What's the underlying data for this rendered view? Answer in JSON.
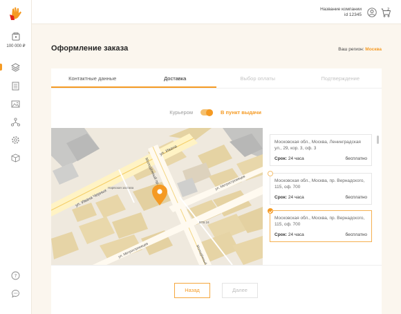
{
  "sidebar": {
    "balance": "100 000 ₽",
    "nav_icons": [
      "layers-icon",
      "document-icon",
      "image-icon",
      "network-icon",
      "settings-icon",
      "box-icon"
    ],
    "bottom_icons": [
      "help-icon",
      "chat-icon"
    ]
  },
  "header": {
    "company_name": "Название компании",
    "company_id": "id 12345",
    "cart_count": "2"
  },
  "page": {
    "title": "Оформление заказа",
    "region_label": "Ваш регион:",
    "region_value": "Москва"
  },
  "tabs": [
    {
      "label": "Контактные данные",
      "state": "done"
    },
    {
      "label": "Доставка",
      "state": "active"
    },
    {
      "label": "Выбор оплаты",
      "state": "disabled"
    },
    {
      "label": "Подтверждение",
      "state": "disabled"
    }
  ],
  "delivery_toggle": {
    "option_off": "Курьером",
    "option_on": "В пункт выдачи",
    "selected": "В пункт выдачи"
  },
  "map": {
    "street_labels": [
      "ул. Ивана Черных",
      "ул. Ивана",
      "Молодёжный пр.",
      "ул. Метростроевцев",
      "ул. Метростроевцев",
      "Молодёжный"
    ],
    "poi_labels": [
      "Нарвская застава",
      "ВТБ 24"
    ]
  },
  "pickup_points": [
    {
      "address": "Московская обл., Москва, Ленинградская ул., 29, кор. 3, оф. 3",
      "term_label": "Срок:",
      "term": "24 часа",
      "price": "бесплатно",
      "selected": false
    },
    {
      "address": "Московская обл., Москва, пр. Вернадского, 115, оф. 700",
      "term_label": "Срок:",
      "term": "24 часа",
      "price": "бесплатно",
      "selected": false
    },
    {
      "address": "Московская обл., Москва, пр. Вернадского, 115, оф. 700",
      "term_label": "Срок:",
      "term": "24 часа",
      "price": "бесплатно",
      "selected": true
    }
  ],
  "buttons": {
    "back": "Назад",
    "next": "Далее"
  },
  "colors": {
    "accent": "#f59a23",
    "background": "#fbf6ee"
  }
}
